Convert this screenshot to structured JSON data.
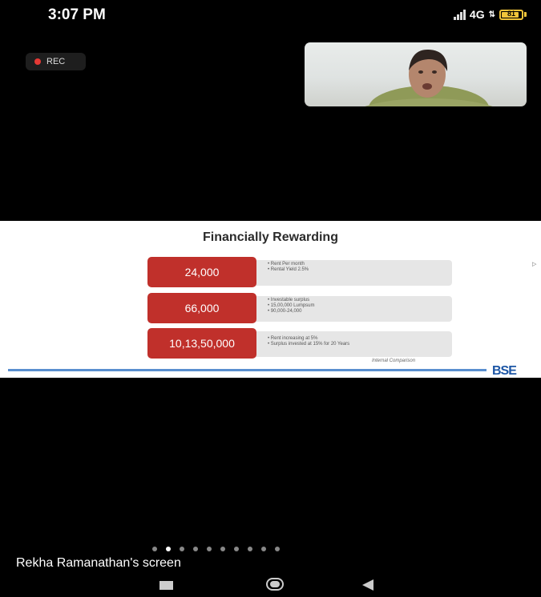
{
  "status_bar": {
    "time": "3:07 PM",
    "network": "4G",
    "battery": "81"
  },
  "recording": {
    "label": "REC"
  },
  "slide": {
    "title": "Financially Rewarding",
    "rows": [
      {
        "value": "24,000",
        "bullets": [
          "Rent Per month",
          "Rental Yield 2.5%"
        ]
      },
      {
        "value": "66,000",
        "bullets": [
          "Investable surplus",
          "15,00,000 Lumpsum",
          "90,000-24,000"
        ]
      },
      {
        "value": "10,13,50,000",
        "bullets": [
          "Rent increasing at 5%",
          "Surplus invested at 15% for 20 Years"
        ]
      }
    ],
    "footnote": "Internal Comparison",
    "logo": "BSE",
    "accent_color": "#c0302b",
    "bar_color": "#5a8fcf"
  },
  "pager": {
    "count": 10,
    "active_index": 1
  },
  "screen_label": "Rekha Ramanathan's screen",
  "nav": {
    "items": [
      "recents-button",
      "home-button",
      "back-button"
    ]
  }
}
